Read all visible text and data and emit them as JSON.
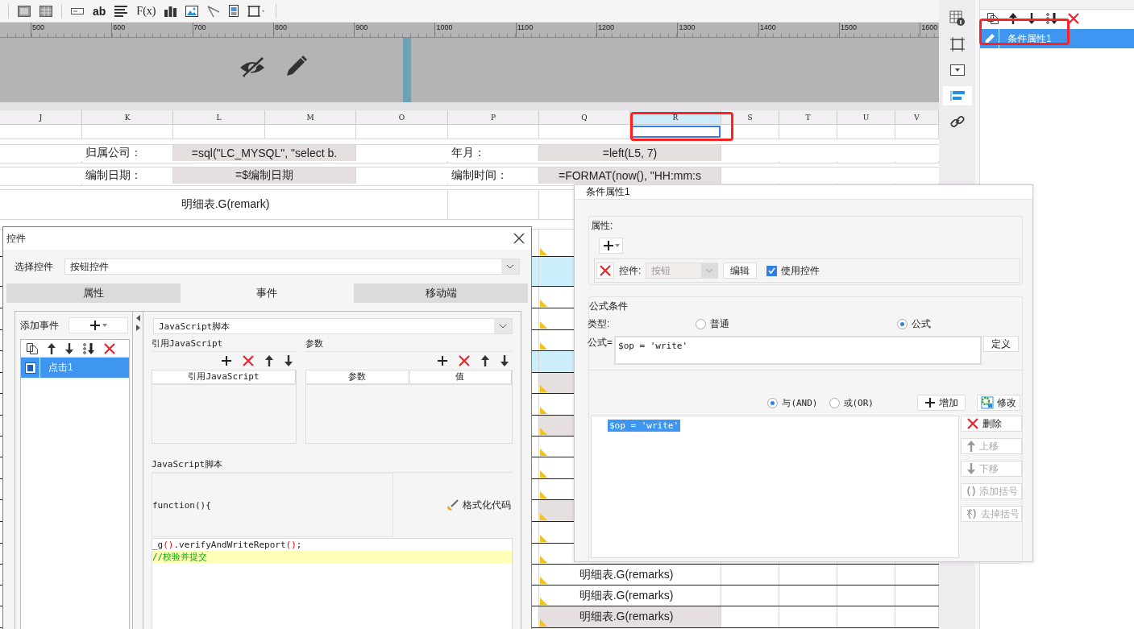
{
  "toolbar": {
    "text_tools": [
      "ab",
      "F(x)"
    ]
  },
  "ruler": {
    "labels": [
      "500",
      "600",
      "700",
      "800",
      "900",
      "1000",
      "1100",
      "1200",
      "1300",
      "1400",
      "1500",
      "1600"
    ]
  },
  "sheet": {
    "columns": [
      {
        "label": "J",
        "selected": false
      },
      {
        "label": "K",
        "selected": false
      },
      {
        "label": "L",
        "selected": false
      },
      {
        "label": "M",
        "selected": false
      },
      {
        "label": "O",
        "selected": false
      },
      {
        "label": "P",
        "selected": false
      },
      {
        "label": "Q",
        "selected": false
      },
      {
        "label": "R",
        "selected": true
      },
      {
        "label": "S",
        "selected": false
      },
      {
        "label": "T",
        "selected": false
      },
      {
        "label": "U",
        "selected": false
      },
      {
        "label": "V",
        "selected": false
      }
    ],
    "info_rows": [
      {
        "cells": [
          {
            "text": "归属公司：",
            "shaded": false
          },
          {
            "text": "=sql(\"LC_MYSQL\", \"select b.",
            "shaded": true
          },
          {
            "text": "年月：",
            "shaded": false
          },
          {
            "text": "=left(L5, 7)",
            "shaded": true
          }
        ]
      },
      {
        "cells": [
          {
            "text": "编制日期：",
            "shaded": false
          },
          {
            "text": "=$编制日期",
            "shaded": true
          },
          {
            "text": "编制时间：",
            "shaded": false
          },
          {
            "text": "=FORMAT(now(), \"HH:mm:s",
            "shaded": true
          }
        ]
      },
      {
        "cells": [
          {
            "text": "明细表.G(remark)",
            "shaded": false
          }
        ]
      }
    ],
    "detail_rows": [
      {
        "kind": "white"
      },
      {
        "kind": "blue"
      },
      {
        "kind": "white"
      },
      {
        "kind": "white"
      },
      {
        "kind": "white"
      },
      {
        "kind": "blue"
      },
      {
        "kind": "beige"
      },
      {
        "kind": "white"
      },
      {
        "kind": "beige"
      },
      {
        "kind": "white"
      },
      {
        "kind": "white"
      },
      {
        "kind": "white"
      },
      {
        "kind": "beige"
      },
      {
        "kind": "white"
      },
      {
        "kind": "white"
      },
      {
        "kind": "white",
        "text": "明细表.G(remarks)"
      },
      {
        "kind": "white",
        "text": "明细表.G(remarks)"
      },
      {
        "kind": "beige",
        "text": "明细表.G(remarks)"
      }
    ]
  },
  "side_tools": [
    {
      "selected": false
    },
    {
      "selected": false
    },
    {
      "selected": false
    },
    {
      "selected": true
    },
    {
      "selected": false
    }
  ],
  "panel": {
    "items": [
      {
        "label": "条件属性1",
        "selected": true
      }
    ]
  },
  "highlights": [
    {
      "kind": "frame"
    },
    {
      "kind": "frame"
    }
  ],
  "control_dialog": {
    "title": "控件",
    "select_label": "选择控件",
    "select_value": "按钮控件",
    "tabs": [
      {
        "label": "属性",
        "selected": false
      },
      {
        "label": "事件",
        "selected": true
      },
      {
        "label": "移动端",
        "selected": false
      }
    ],
    "add_event_label": "添加事件",
    "events": [
      {
        "label": "点击1",
        "selected": true
      }
    ],
    "event_type": "JavaScript脚本",
    "ref_section": "引用JavaScript",
    "ref_columns": [
      "引用JavaScript"
    ],
    "param_section": "参数",
    "param_columns": [
      "参数",
      "值"
    ],
    "script_section": "JavaScript脚本",
    "function_header": "function(){",
    "format_button": "格式化代码",
    "code_lines": [
      {
        "highlighted": false,
        "segments": [
          {
            "text": "_g",
            "kind": "plain"
          },
          {
            "text": "()",
            "kind": "paren"
          },
          {
            "text": ".verifyAndWriteReport",
            "kind": "plain"
          },
          {
            "text": "()",
            "kind": "paren"
          },
          {
            "text": ";",
            "kind": "plain"
          }
        ]
      },
      {
        "highlighted": true,
        "segments": [
          {
            "text": "//校验并提交",
            "kind": "comment"
          }
        ]
      }
    ]
  },
  "condition_dialog": {
    "title": "条件属性1",
    "props_label": "属性:",
    "control_label": "控件:",
    "control_value": "按钮",
    "control_disabled": true,
    "edit_button": "编辑",
    "use_control": {
      "label": "使用控件",
      "checked": true
    },
    "formula_section": "公式条件",
    "type_label": "类型:",
    "type_options": [
      {
        "label": "普通",
        "selected": false
      },
      {
        "label": "公式",
        "selected": true
      }
    ],
    "formula_label": "公式=",
    "formula_value": "$op = 'write'",
    "define_button": "定义",
    "joins": [
      {
        "label": "与(AND)",
        "selected": true
      },
      {
        "label": "或(OR)",
        "selected": false
      }
    ],
    "add_button": "增加",
    "modify_button": "修改",
    "conditions": [
      {
        "text": "$op = 'write'",
        "selected": true
      }
    ],
    "side_buttons": [
      {
        "label": "删除",
        "kind": "delete",
        "disabled": false
      },
      {
        "label": "上移",
        "kind": "up",
        "disabled": true
      },
      {
        "label": "下移",
        "kind": "down",
        "disabled": true
      },
      {
        "label": "添加括号",
        "kind": "add-paren",
        "disabled": true
      },
      {
        "label": "去掉括号",
        "kind": "remove-paren",
        "disabled": true
      }
    ]
  }
}
